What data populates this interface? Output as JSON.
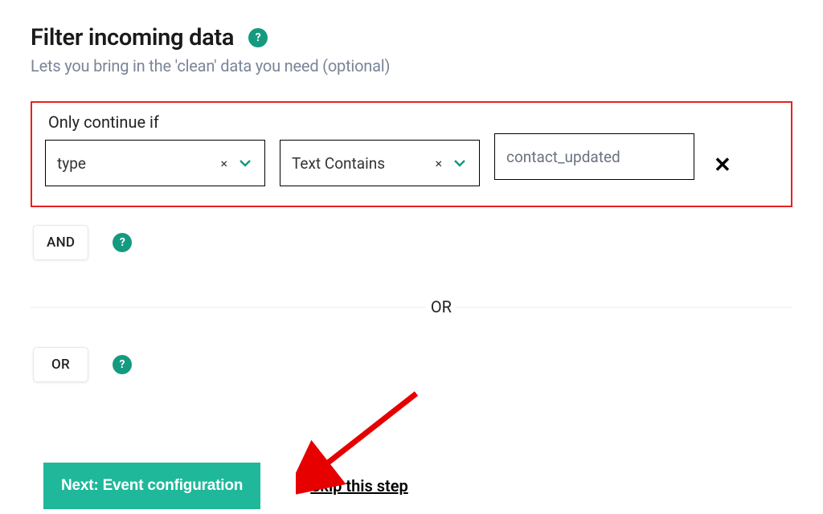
{
  "header": {
    "title": "Filter incoming data",
    "subtitle": "Lets you bring in the 'clean' data you need (optional)"
  },
  "condition": {
    "label": "Only continue if",
    "field": "type",
    "operator": "Text Contains",
    "value": "contact_updated"
  },
  "logic": {
    "and_label": "AND",
    "or_divider": "OR",
    "or_label": "OR"
  },
  "footer": {
    "next": "Next: Event configuration",
    "skip": "Skip this step"
  },
  "icons": {
    "help": "?",
    "clear": "×",
    "remove": "✕"
  }
}
